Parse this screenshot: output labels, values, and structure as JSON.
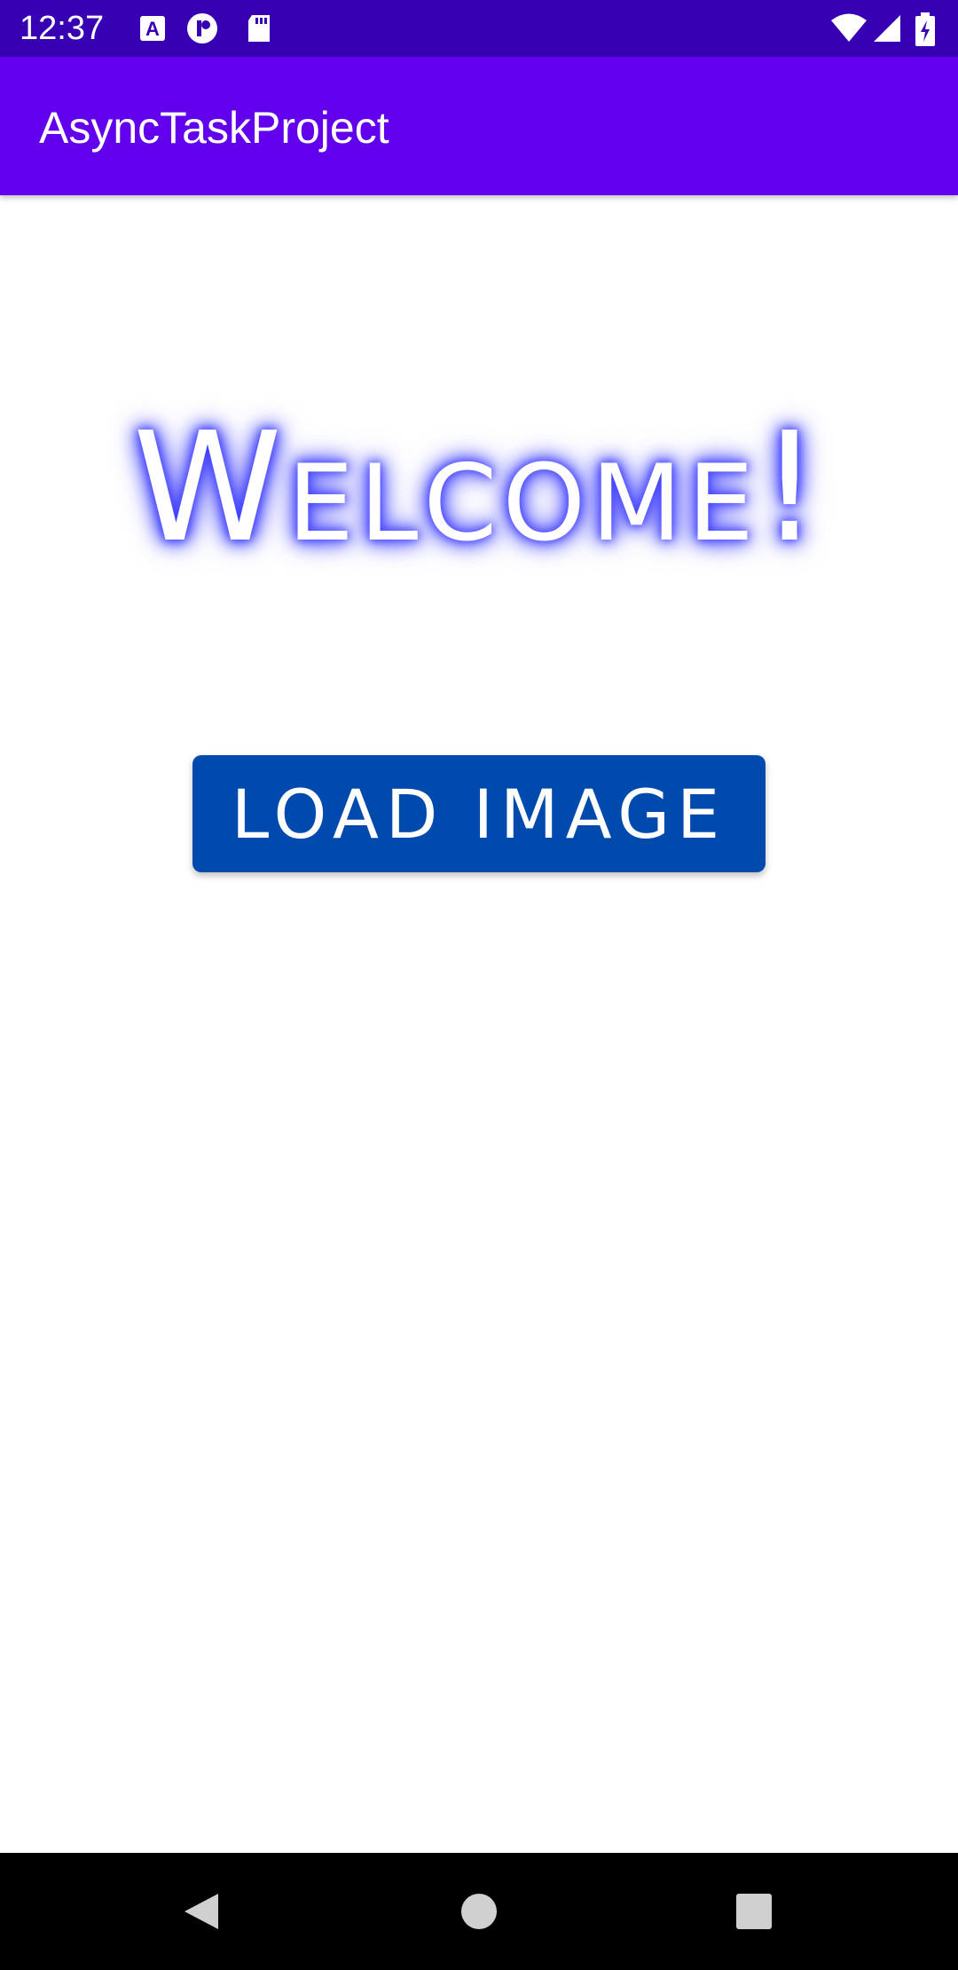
{
  "status_bar": {
    "time": "12:37",
    "icons": [
      "app-a-icon",
      "app-circle-icon",
      "sd-card-icon",
      "wifi-icon",
      "signal-icon",
      "battery-charging-icon"
    ],
    "color": "#3700b3"
  },
  "app_bar": {
    "title": "AsyncTaskProject",
    "color": "#6200ee"
  },
  "main": {
    "welcome_text": "Welcome!",
    "button_label": "LOAD IMAGE",
    "button_color": "#004aad"
  },
  "nav_bar": {
    "icons": [
      "back-icon",
      "home-icon",
      "recents-icon"
    ]
  }
}
